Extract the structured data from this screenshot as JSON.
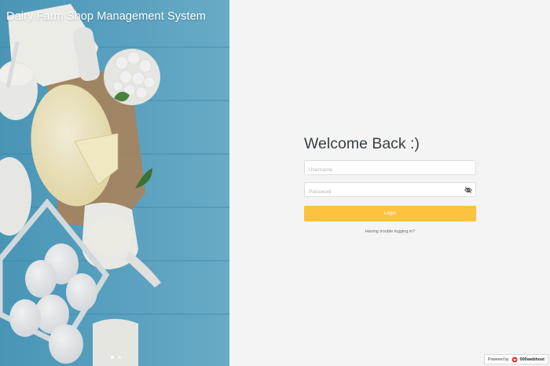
{
  "hero": {
    "title": "Dairy Farm Shop Management System",
    "carousel_total": 2,
    "carousel_active": 1
  },
  "login": {
    "heading": "Welcome Back :)",
    "username_placeholder": "Username",
    "password_placeholder": "Password",
    "login_label": "Login",
    "trouble_link": "Having trouble logging in?"
  },
  "footer": {
    "powered_by": "Powered by",
    "brand": "000webhost"
  },
  "colors": {
    "accent": "#fdc23e",
    "panel_bg": "#f4f4f4",
    "heading_text": "#3a3f44"
  },
  "icons": {
    "password_toggle": "eye-slash-icon",
    "brand_logo": "000webhost-logo-icon"
  }
}
